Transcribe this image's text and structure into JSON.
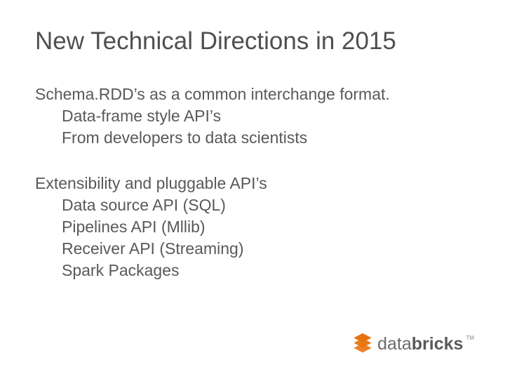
{
  "title": "New Technical Directions in 2015",
  "sections": [
    {
      "lead": "Schema.RDD’s as a common interchange format.",
      "items": [
        "Data-frame style API’s",
        "From developers to data scientists"
      ]
    },
    {
      "lead": "Extensibility and pluggable API’s",
      "items": [
        "Data source API (SQL)",
        "Pipelines API (Mllib)",
        "Receiver API (Streaming)",
        "Spark Packages"
      ]
    }
  ],
  "logo": {
    "brand_prefix": "data",
    "brand_suffix": "bricks",
    "tm": "TM"
  }
}
